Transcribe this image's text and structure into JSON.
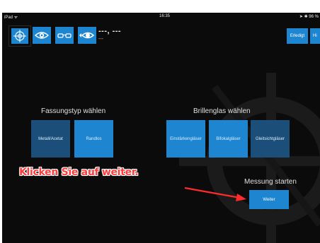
{
  "status_bar": {
    "carrier": "iPad ᯤ",
    "time": "16:35",
    "right": "➤ ✱ 96 %"
  },
  "toolbar": {
    "readout_main": "---, ---",
    "readout_sub": "---",
    "done_label": "Erledigt",
    "help_label": "Hi"
  },
  "frame_section": {
    "title": "Fassungstyp wählen",
    "options": [
      "Metall/Acetat",
      "Randlos"
    ]
  },
  "lens_section": {
    "title": "Brillenglas wählen",
    "options": [
      "Einstärkengläser",
      "Bifokalgläser",
      "Gleitsichtgläser"
    ]
  },
  "start_section": {
    "title": "Messung starten",
    "next_label": "Weiter"
  },
  "annotation": {
    "instruction": "Klicken Sie auf weiter."
  },
  "colors": {
    "accent": "#1e86d0",
    "accent_dark": "#1b4f7a",
    "background": "#0b0b0b",
    "annotation": "#ff3b3b"
  }
}
